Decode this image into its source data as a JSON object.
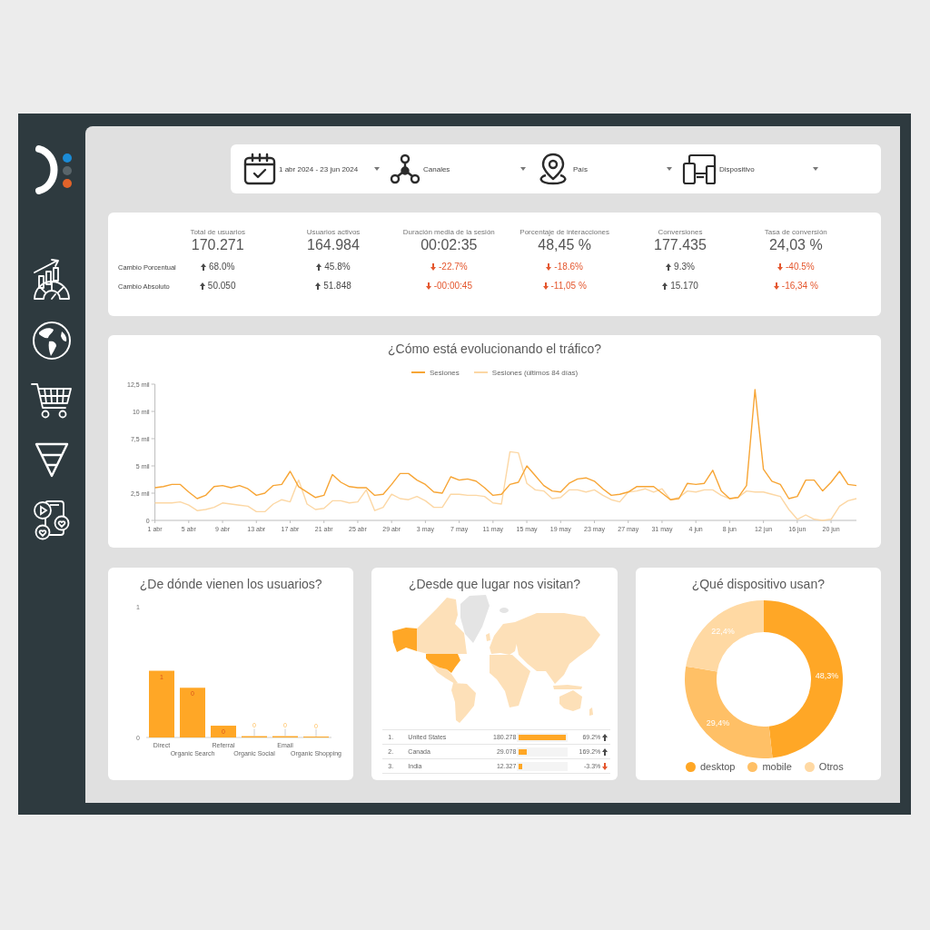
{
  "filters": [
    {
      "kind": "date",
      "label": "1 abr 2024 - 23 jun 2024"
    },
    {
      "kind": "channel",
      "label": "Canales"
    },
    {
      "kind": "location",
      "label": "País"
    },
    {
      "kind": "device",
      "label": "Dispositivo"
    }
  ],
  "scorecards": {
    "row_labels": [
      "Cambio Porcentual",
      "Cambio Absoluto"
    ],
    "metrics": [
      {
        "label": "Total de usuarios",
        "value": "170.271",
        "changes": [
          {
            "text": "68.0%",
            "up": true
          },
          {
            "text": "50.050",
            "up": true
          }
        ]
      },
      {
        "label": "Usuarios activos",
        "value": "164.984",
        "changes": [
          {
            "text": "45.8%",
            "up": true
          },
          {
            "text": "51.848",
            "up": true
          }
        ]
      },
      {
        "label": "Duración media de la sesión",
        "value": "00:02:35",
        "changes": [
          {
            "text": "-22.7%",
            "up": false
          },
          {
            "text": "-00:00:45",
            "up": false
          }
        ]
      },
      {
        "label": "Porcentaje de interacciones",
        "value": "48,45 %",
        "changes": [
          {
            "text": "-18.6%",
            "up": false
          },
          {
            "text": "-11,05 %",
            "up": false
          }
        ]
      },
      {
        "label": "Conversiones",
        "value": "177.435",
        "changes": [
          {
            "text": "9.3%",
            "up": true
          },
          {
            "text": "15.170",
            "up": true
          }
        ]
      },
      {
        "label": "Tasa de conversión",
        "value": "24,03 %",
        "changes": [
          {
            "text": "-40.5%",
            "up": false
          },
          {
            "text": "-16,34 %",
            "up": false
          }
        ]
      }
    ]
  },
  "traffic": {
    "chart_data": {
      "type": "line",
      "title": "¿Cómo está evolucionando el tráfico?",
      "legend": "top",
      "categories": [
        "1 abr",
        null,
        null,
        null,
        "5 abr",
        null,
        null,
        null,
        "9 abr",
        null,
        null,
        null,
        "13 abr",
        null,
        null,
        null,
        "17 abr",
        null,
        null,
        null,
        "21 abr",
        null,
        null,
        null,
        "25 abr",
        null,
        null,
        null,
        "29 abr",
        null,
        null,
        null,
        "3 may",
        null,
        null,
        null,
        "7 may",
        null,
        null,
        null,
        "11 may",
        null,
        null,
        null,
        "15 may",
        null,
        null,
        null,
        "19 may",
        null,
        null,
        null,
        "23 may",
        null,
        null,
        null,
        "27 may",
        null,
        null,
        null,
        "31 may",
        null,
        null,
        null,
        "4 jun",
        null,
        null,
        null,
        "8 jun",
        null,
        null,
        null,
        "12 jun",
        null,
        null,
        null,
        "16 jun",
        null,
        null,
        null,
        "20 jun",
        null,
        null,
        null
      ],
      "ylim": [
        0,
        12.5
      ],
      "yticks": [
        {
          "value": 0,
          "label": "0"
        },
        {
          "value": 2.5,
          "label": "2,5 mil"
        },
        {
          "value": 5,
          "label": "5 mil"
        },
        {
          "value": 7.5,
          "label": "7,5 mil"
        },
        {
          "value": 10,
          "label": "10 mil"
        },
        {
          "value": 12.5,
          "label": "12,5 mil"
        }
      ],
      "series": [
        {
          "name": "Sesiones",
          "color": "#f7a535",
          "values": [
            3.0,
            3.1,
            3.3,
            3.3,
            2.6,
            2.0,
            2.3,
            3.1,
            3.2,
            3.0,
            3.2,
            2.9,
            2.3,
            2.5,
            3.2,
            3.3,
            4.5,
            3.1,
            2.6,
            2.1,
            2.3,
            4.2,
            3.5,
            3.1,
            3.0,
            3.0,
            2.3,
            2.4,
            3.3,
            4.3,
            4.3,
            3.7,
            3.3,
            2.6,
            2.5,
            4.0,
            3.7,
            3.8,
            3.6,
            3.0,
            2.3,
            2.4,
            3.3,
            3.5,
            5.0,
            4.1,
            3.2,
            2.7,
            2.6,
            3.4,
            3.8,
            3.9,
            3.6,
            2.9,
            2.3,
            2.4,
            2.6,
            3.1,
            3.1,
            3.1,
            2.5,
            1.9,
            2.0,
            3.4,
            3.3,
            3.4,
            4.6,
            2.7,
            2.0,
            2.1,
            3.2,
            12.0,
            4.7,
            3.6,
            3.3,
            2.0,
            2.2,
            3.7,
            3.7,
            2.7,
            3.5,
            4.5,
            3.3,
            3.2
          ]
        },
        {
          "name": "Sesiones (últimos 84 días)",
          "color": "#fcd7a4",
          "values": [
            1.6,
            1.6,
            1.6,
            1.7,
            1.4,
            0.9,
            1.0,
            1.2,
            1.6,
            1.5,
            1.4,
            1.3,
            0.8,
            0.8,
            1.5,
            1.9,
            1.7,
            3.7,
            1.5,
            1.0,
            1.1,
            1.8,
            1.8,
            1.6,
            1.7,
            2.8,
            0.9,
            1.2,
            2.4,
            2.0,
            1.9,
            2.2,
            1.8,
            1.2,
            1.2,
            2.4,
            2.4,
            2.3,
            2.3,
            2.2,
            1.6,
            1.5,
            6.3,
            6.2,
            3.4,
            2.8,
            2.7,
            2.0,
            2.1,
            2.8,
            2.8,
            2.6,
            2.8,
            2.3,
            1.9,
            1.7,
            2.6,
            2.7,
            2.9,
            2.6,
            2.9,
            1.9,
            2.1,
            2.7,
            2.6,
            2.8,
            2.8,
            2.3,
            2.0,
            2.1,
            2.7,
            2.6,
            2.6,
            2.4,
            2.2,
            1.0,
            0.1,
            0.5,
            0.1,
            0.0,
            0.1,
            1.3,
            1.8,
            2.0
          ]
        }
      ]
    }
  },
  "sources": {
    "chart_data": {
      "type": "bar",
      "title": "¿De dónde vienen los usuarios?",
      "categories": [
        "Direct",
        "Organic Search",
        "Referral",
        "Organic Social",
        "Email",
        "Organic Shopping"
      ],
      "values": [
        0.51,
        0.38,
        0.09,
        0.01,
        0.01,
        0.005
      ],
      "ylim": [
        0,
        1
      ],
      "yticks": [
        0,
        1
      ],
      "value_labels": [
        "1",
        "0",
        "0",
        "0",
        "0",
        "0"
      ]
    }
  },
  "geo": {
    "title": "¿Desde que lugar nos visitan?",
    "rows": [
      {
        "rank": "1.",
        "country": "United States",
        "value": "180.278",
        "level": 1,
        "change": "69.2%",
        "up": true
      },
      {
        "rank": "2.",
        "country": "Canada",
        "value": "29.078",
        "level": 0.16,
        "change": "169.2%",
        "up": true
      },
      {
        "rank": "3.",
        "country": "India",
        "value": "12.327",
        "level": 0.07,
        "change": "-3.3%",
        "up": false
      }
    ]
  },
  "devices": {
    "chart_data": {
      "type": "donut",
      "title": "¿Qué dispositivo usan?",
      "legend": "bottom",
      "categories": [
        "desktop",
        "mobile",
        "Otros"
      ],
      "values": [
        48.3,
        29.4,
        22.4
      ],
      "colors": [
        "#ffa726",
        "#ffc066",
        "#ffd9a3"
      ],
      "value_labels": [
        "48,3%",
        "29,4%",
        "22,4%"
      ]
    }
  }
}
